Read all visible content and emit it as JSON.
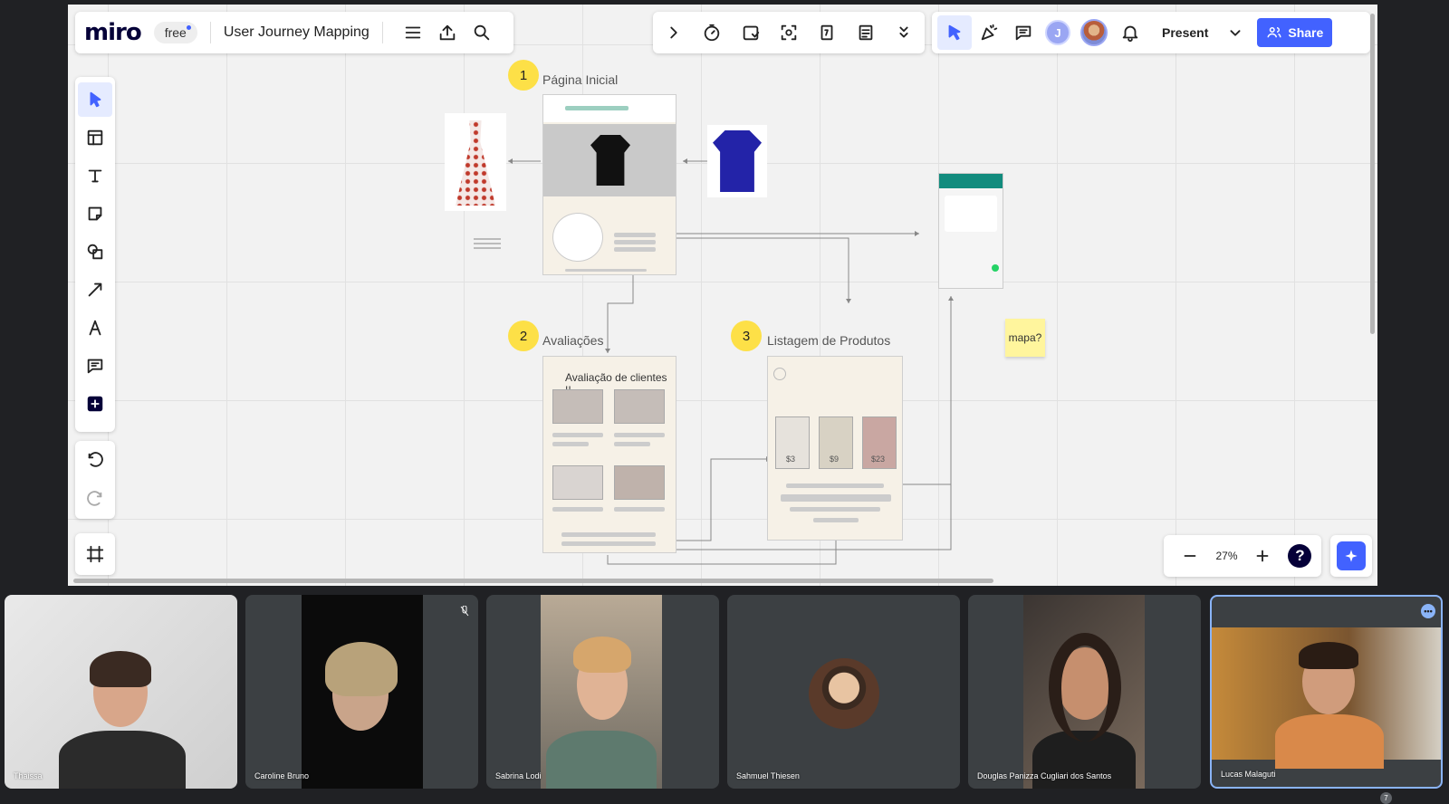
{
  "app": {
    "logo": "miro",
    "plan_badge": "free",
    "board_title": "User Journey Mapping",
    "present_label": "Present",
    "share_label": "Share",
    "avatar_initial": "J",
    "zoom_level": "27%",
    "help_label": "?"
  },
  "icons": {
    "top_left": [
      "menu-icon",
      "upload-icon",
      "search-icon"
    ],
    "top_mid": [
      "chevron-right-icon",
      "timer-icon",
      "voting-icon",
      "focus-icon",
      "card-icon",
      "notes-icon",
      "chevron-down-double-icon"
    ],
    "top_right": [
      "cursor-follow-icon",
      "celebrate-icon",
      "comments-icon",
      "bell-icon"
    ],
    "left_toolbar": [
      "select-icon",
      "templates-icon",
      "text-icon",
      "sticky-note-icon",
      "shapes-icon",
      "arrow-pen-icon",
      "pen-icon",
      "comment-icon",
      "add-icon"
    ],
    "history": [
      "undo-icon",
      "redo-icon"
    ]
  },
  "board": {
    "sections": [
      {
        "number": "1",
        "title": "Página Inicial"
      },
      {
        "number": "2",
        "title": "Avaliações"
      },
      {
        "number": "3",
        "title": "Listagem de Produtos"
      }
    ],
    "review_heading": "Avaliação de clientes !!",
    "prices": [
      "$3",
      "$9",
      "$23"
    ],
    "sticky_note": "mapa?"
  },
  "participants": [
    {
      "name": "Thaissa"
    },
    {
      "name": "Caroline Bruno"
    },
    {
      "name": "Sabrina Lodi"
    },
    {
      "name": "Sahmuel Thiesen"
    },
    {
      "name": "Douglas Panizza Cugliari dos Santos"
    },
    {
      "name": "Lucas Malaguti"
    }
  ],
  "participant_count": "7",
  "colors": {
    "accent": "#4262ff",
    "badge": "#fde047",
    "sticky": "#fff59d",
    "meet_bg": "#202124"
  }
}
